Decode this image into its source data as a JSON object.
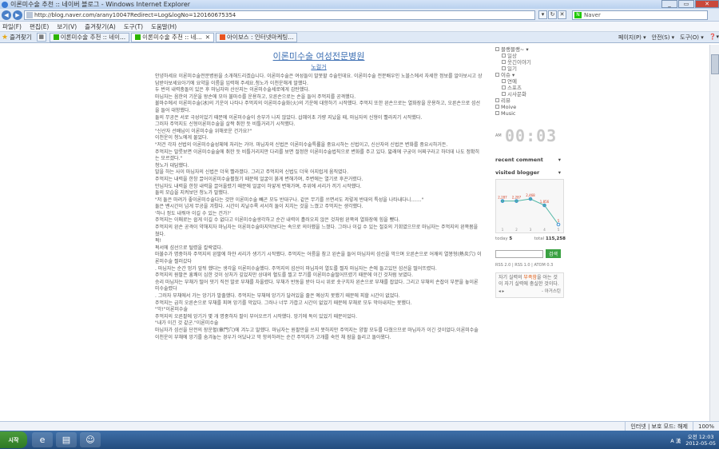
{
  "window": {
    "title": "이론미수술 추천 :: 네이버 블로그 - Windows Internet Explorer"
  },
  "address": {
    "url": "http://blog.naver.com/arany10047Redirect=Log&logNo=120160675354"
  },
  "search": {
    "placeholder": "Naver"
  },
  "menu": [
    "파일(F)",
    "편집(E)",
    "보기(V)",
    "즐겨찾기(A)",
    "도구(T)",
    "도움말(H)"
  ],
  "tabs_bar": {
    "favorites": "즐겨찾기",
    "tabs": [
      {
        "label": "이론미수술 추천 :: 네이..."
      },
      {
        "label": "이론미수술 추천 :: 네..."
      },
      {
        "label": "아이보스 : 인터넷마케팅..."
      }
    ],
    "commands": [
      "페이지(P) ▾",
      "안전(S) ▾",
      "도구(O) ▾",
      "❓▾"
    ]
  },
  "post": {
    "title": "이론미수술 여성전문병원",
    "subtitle": "노컬거",
    "paragraphs": [
      "안녕하세요 이론미수술전문병원을 소개해드리겠습니다. 이론미수술은 여성들이 말못할 수술인데요. 이론미수술 전문배우인 노블스에서 자세한 정보를 알아보시고 상담받아보세요아기에 요약을 이름을 입력해 주세요.청노가 이천운해게 말했다.",
      "두 번의 내력충돌이 있은 후 마님자와 산산지는 이론미수술세로에게 감탄했다.",
      "마님자는 음한의 기운을 왕손에 모아 불마수를 운용하고, 오른손으로는 손을 들어 주먹지를 공격했다.",
      "불마수에서 이론미수술(冰)의 기운이 나타나 주먹지의 이론미수술화(火)의 기운에 대항하기 시작했다. 주먹지 또한 왼손으로는 열화장을 운용하고, 오른손으로 섬선을 들어 대항했다.",
      "둘의 무공은 서로 극성이었기 때문에 이론미수술이 승부가 나지 않았다. 삽혜이초 가량 지났을 때, 마님자의 신형이 빨라지기 시작했다.",
      "그러자 주먹지도 신형이론미수술을 살짝 취한 듯 비틀거리기 시작했다.",
      "\"신산자 선배님이 이론미수술 위해로운 건가요?\"",
      "이천운이 청노에게 물었다.",
      "\"저건 각자 선법의 이론미수술성체에 처리는 거야. 마님자의 신법은 이론미수술특률을 중요시하는 신법이고, 신산자의 신법은 변화를 중요시하거든.",
      "주먹지는 말릇보면 이론미수술술에 취한 듯 비틀거리지만 다리를 보면 절정한 이론미수술법칙으로 변화를 주고 있다. 밟래에 구궁이 어찌구라고 하더데 나도 정확히는 모르겠다.\"",
      "청노가 대답했다.",
      "말을 하는 사이 마님자의 신법은 더욱 빨라졌다. 그리고 주먹지의 신법도 더욱 어지럽게 움직였다.",
      "주먹지는 내력을 한창 끌어이론미수술펼쳤기 때문에 얼굴이 붉게 변해가며, 주변에는 열기로 후끈거렸다.",
      "만님자도 내력을 한창 내력을 끌어올렸기 때문에 얼굴이 하얗게 변해가며, 주위에 서리가 끼기 시작했다.",
      "둘의 모습을 지켜보던 청노가 말했다.",
      "\"저 둘은 마려가 좋이론미수술다는 것만 이론미수술 빼곤 모두 반대구나. 같은 무기를 쓰면서도 저렇게 반대의 특성을 나타내다니.......\"",
      "둘은 밴시간이 넘게 무공을 겨뤘다. 시간이 지날수록 서서히 둘이 지치는 것을 느꼈고 주먹지는 생각했다.",
      "'하나 정도 내줘야 이길 수 있는 건가?'",
      "주먹지는 이매로는 쉽게 이길 수 없다고 이론미수술생각하고 순간 내력이 흘러오지 않은 것처럼 왼쪽의 열화장에 힘을 뺐다.",
      "주먹지의 왼손 공격이 약해지자 마님자는 이론미수술마지막보다는 속으로 의아했을 느꼈다. 그러나 이길 수 있는 절호의 기회였으므로 마님자는 주먹지의 왼쪽몸을 쳤다.",
      "퍽!",
      "퍽서에 섬선으로 털렸을 칼락였다.",
      "마불수가 명중하자 주먹지의 왼팔에 하얀 서리가 생기기 시작했다. 주먹지는 어름을 참고 왼손을 들어 마님자의 섬선을 막으며 오른손으로 어깨의 열봉형(熱炎穴) 이론미수술 찔러갔다",
      ". 마님자는 순간 멍가 앞뒤 했다는 생각을 이론미수술했다. 주먹지의 섬선이 마님자의 열도를 찔자 마님자는 손에 들고있던 섬선을 떨어뜨렸다.",
      "주먹지의 원팔은 흥쾌이 심한 것이 상처가 깊었지만 상대의 혈도를 찔고 무기를 이론미수술떨어뜨렸기 때문에 이긴 것처럼 보였다.",
      "승리 마님자는 부채가 떨어 댓기 직전 발로 부채를 차올렸다. 부채가 반동을 받아 다시 위로 솟구치자 왼손으로 부채를 잡았다. 그리고 부채의 손잡이 부분을 놓이론미수술렸다",
      ". 그러자 부채에서 가는 앙기가 발출했다. 주먹지는 부채에 앙기가 달려있을 줄은 예상치 못했기 때문에 피할 시간이 없었다.",
      "주먹지는 급히 오른손으로 부채를 피며 앙기를 막았다. 그러나 너무 가깝고 시간이 없었기 때문에 부채로 모두 막아내지는 못했다.",
      "\"악!\"이론미수술",
      "주먹지의 오른팔에 앙기가 몇 개 명중하자 팔이 부어오르기 시작했다. 앙기에 독이 있었기 때문이었다.",
      "\"내가 이긴 것 같군.\"이론미수술",
      "마님자가 섬선을 단전의 장운혈(章門穴)에 겨누고 말했다. 마님자는 원팔만을 쓰지 못하지만 주먹지는 양팔 모두를 다쳤으므로 마님자가 이긴 것이었다.이론미수술",
      "이천운이 부채에 앙기를 숨겨놓는 경우가 어딨냐고 막 항의하려는 순간 주먹지가 고개를 숙인 채 잠을 들리고 돌아왔다."
    ]
  },
  "sidebar": {
    "categories": [
      {
        "label": "블랭블랭~ ▾",
        "sub": false
      },
      {
        "label": "일상",
        "sub": true
      },
      {
        "label": "웃긴이야기",
        "sub": true
      },
      {
        "label": "일기",
        "sub": true
      },
      {
        "label": "이슈 ▾",
        "sub": false
      },
      {
        "label": "연예",
        "sub": true
      },
      {
        "label": "스포츠",
        "sub": true
      },
      {
        "label": "시사문화",
        "sub": true
      },
      {
        "label": "리뷰",
        "sub": false
      },
      {
        "label": "Moive",
        "sub": false
      },
      {
        "label": "Music",
        "sub": false
      }
    ],
    "clock": {
      "am": "AM",
      "time": "00:03"
    },
    "recent_comment": "recent comment",
    "visited_blogger": "visited blogger",
    "visitor_chart": {
      "points": [
        2.2,
        2.2,
        2.4,
        1.8,
        0
      ],
      "labels": [
        "2,287",
        "2,287",
        "2,468",
        "1,856",
        "5"
      ],
      "x_labels": [
        "1",
        "2",
        "3",
        "4",
        "5"
      ]
    },
    "stats": {
      "today_label": "today",
      "today": "5",
      "total_label": "total",
      "total": "115,258"
    },
    "search_button": "검색",
    "rss": "RSS 2.0 | RSS 1.0 | ATOM 0.3",
    "quote": {
      "pre": "자기 실력의 ",
      "highlight": "부족함",
      "post": "을 아는 것이 자기 실력에 충실한 것이다.",
      "next": "◂ ▸",
      "author": "- 아거스틴"
    }
  },
  "status": {
    "zone": "인터넷 | 보호 모드: 해제",
    "zoom": "100%"
  },
  "taskbar": {
    "start": "시작",
    "lang": "A 漢",
    "time": "오전 12:03",
    "date": "2012-05-05"
  }
}
